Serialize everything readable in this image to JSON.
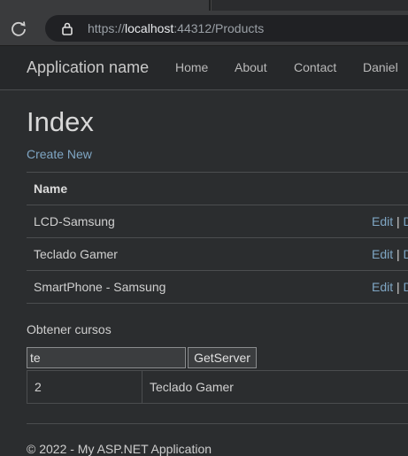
{
  "browser": {
    "url_scheme": "https://",
    "url_host": "localhost",
    "url_rest": ":44312/Products"
  },
  "navbar": {
    "brand": "Application name",
    "links": [
      "Home",
      "About",
      "Contact",
      "Daniel"
    ]
  },
  "page": {
    "title": "Index",
    "create_link": "Create New"
  },
  "products_table": {
    "header": "Name",
    "rows": [
      {
        "name": "LCD-Samsung",
        "edit": "Edit",
        "sep": "|",
        "next": "D"
      },
      {
        "name": "Teclado Gamer",
        "edit": "Edit",
        "sep": "|",
        "next": "D"
      },
      {
        "name": "SmartPhone - Samsung",
        "edit": "Edit",
        "sep": "|",
        "next": "D"
      }
    ]
  },
  "courses": {
    "label": "Obtener cursos",
    "input_value": "te",
    "button_label": "GetServer",
    "results": [
      {
        "id": "2",
        "name": "Teclado Gamer"
      }
    ]
  },
  "footer": {
    "text": "© 2022 - My ASP.NET Application"
  },
  "colors": {
    "background": "#2b2d2f",
    "link": "#7fa6c4",
    "navbar": "#26282a"
  },
  "icons": [
    "reload-icon",
    "lock-icon",
    "tab-close-icon"
  ]
}
